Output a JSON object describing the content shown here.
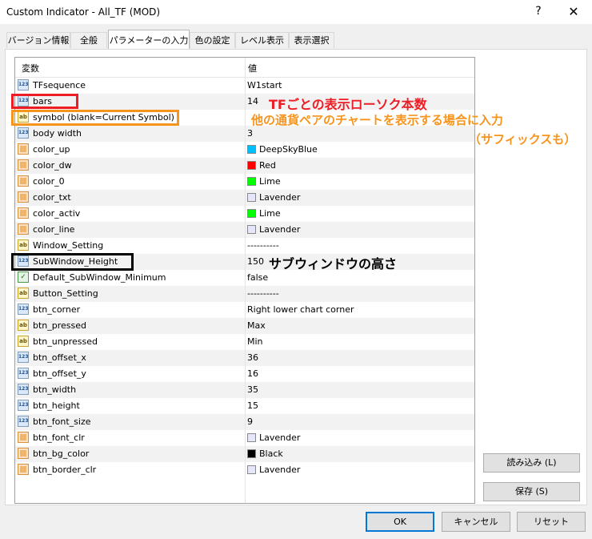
{
  "window": {
    "title": "Custom Indicator - All_TF (MOD)",
    "help": "?",
    "close": "✕"
  },
  "tabs": [
    "バージョン情報",
    "全般",
    "パラメーターの入力",
    "色の設定",
    "レベル表示",
    "表示選択"
  ],
  "grid": {
    "headers": {
      "name": "変数",
      "value": "値"
    },
    "rows": [
      {
        "type": "num",
        "name": "TFsequence",
        "value": "W1start"
      },
      {
        "type": "num",
        "name": "bars",
        "value": "14"
      },
      {
        "type": "ab",
        "name": "symbol (blank=Current Symbol)",
        "value": ""
      },
      {
        "type": "num",
        "name": "body width",
        "value": "3"
      },
      {
        "type": "clr",
        "name": "color_up",
        "value": "DeepSkyBlue",
        "swatch": "#00bfff"
      },
      {
        "type": "clr",
        "name": "color_dw",
        "value": "Red",
        "swatch": "#ff0000"
      },
      {
        "type": "clr",
        "name": "color_0",
        "value": "Lime",
        "swatch": "#00ff00"
      },
      {
        "type": "clr",
        "name": "color_txt",
        "value": "Lavender",
        "swatch": "#e6e6fa"
      },
      {
        "type": "clr",
        "name": "color_activ",
        "value": "Lime",
        "swatch": "#00ff00"
      },
      {
        "type": "clr",
        "name": "color_line",
        "value": "Lavender",
        "swatch": "#e6e6fa"
      },
      {
        "type": "ab",
        "name": "Window_Setting",
        "value": "----------"
      },
      {
        "type": "num",
        "name": "SubWindow_Height",
        "value": "150"
      },
      {
        "type": "bool",
        "name": "Default_SubWindow_Minimum",
        "value": "false"
      },
      {
        "type": "ab",
        "name": "Button_Setting",
        "value": "----------"
      },
      {
        "type": "num",
        "name": "btn_corner",
        "value": "Right lower chart corner"
      },
      {
        "type": "ab",
        "name": "btn_pressed",
        "value": "Max"
      },
      {
        "type": "ab",
        "name": "btn_unpressed",
        "value": "Min"
      },
      {
        "type": "num",
        "name": "btn_offset_x",
        "value": "36"
      },
      {
        "type": "num",
        "name": "btn_offset_y",
        "value": "16"
      },
      {
        "type": "num",
        "name": "btn_width",
        "value": "35"
      },
      {
        "type": "num",
        "name": "btn_height",
        "value": "15"
      },
      {
        "type": "num",
        "name": "btn_font_size",
        "value": "9"
      },
      {
        "type": "clr",
        "name": "btn_font_clr",
        "value": "Lavender",
        "swatch": "#e6e6fa"
      },
      {
        "type": "clr",
        "name": "btn_bg_color",
        "value": "Black",
        "swatch": "#000000"
      },
      {
        "type": "clr",
        "name": "btn_border_clr",
        "value": "Lavender",
        "swatch": "#e6e6fa"
      }
    ]
  },
  "annotations": {
    "bars": "TFごとの表示ローソク本数",
    "symbol_line1": "他の通貨ペアのチャートを表示する場合に入力",
    "symbol_line2": "（サフィックスも）",
    "subwindow": "サブウィンドウの高さ"
  },
  "annotation_colors": {
    "bars": "#ee1c24",
    "symbol": "#f7941d",
    "subwindow": "#000000"
  },
  "side_buttons": {
    "load": "読み込み (L)",
    "save": "保存 (S)"
  },
  "footer_buttons": {
    "ok": "OK",
    "cancel": "キャンセル",
    "reset": "リセット"
  }
}
